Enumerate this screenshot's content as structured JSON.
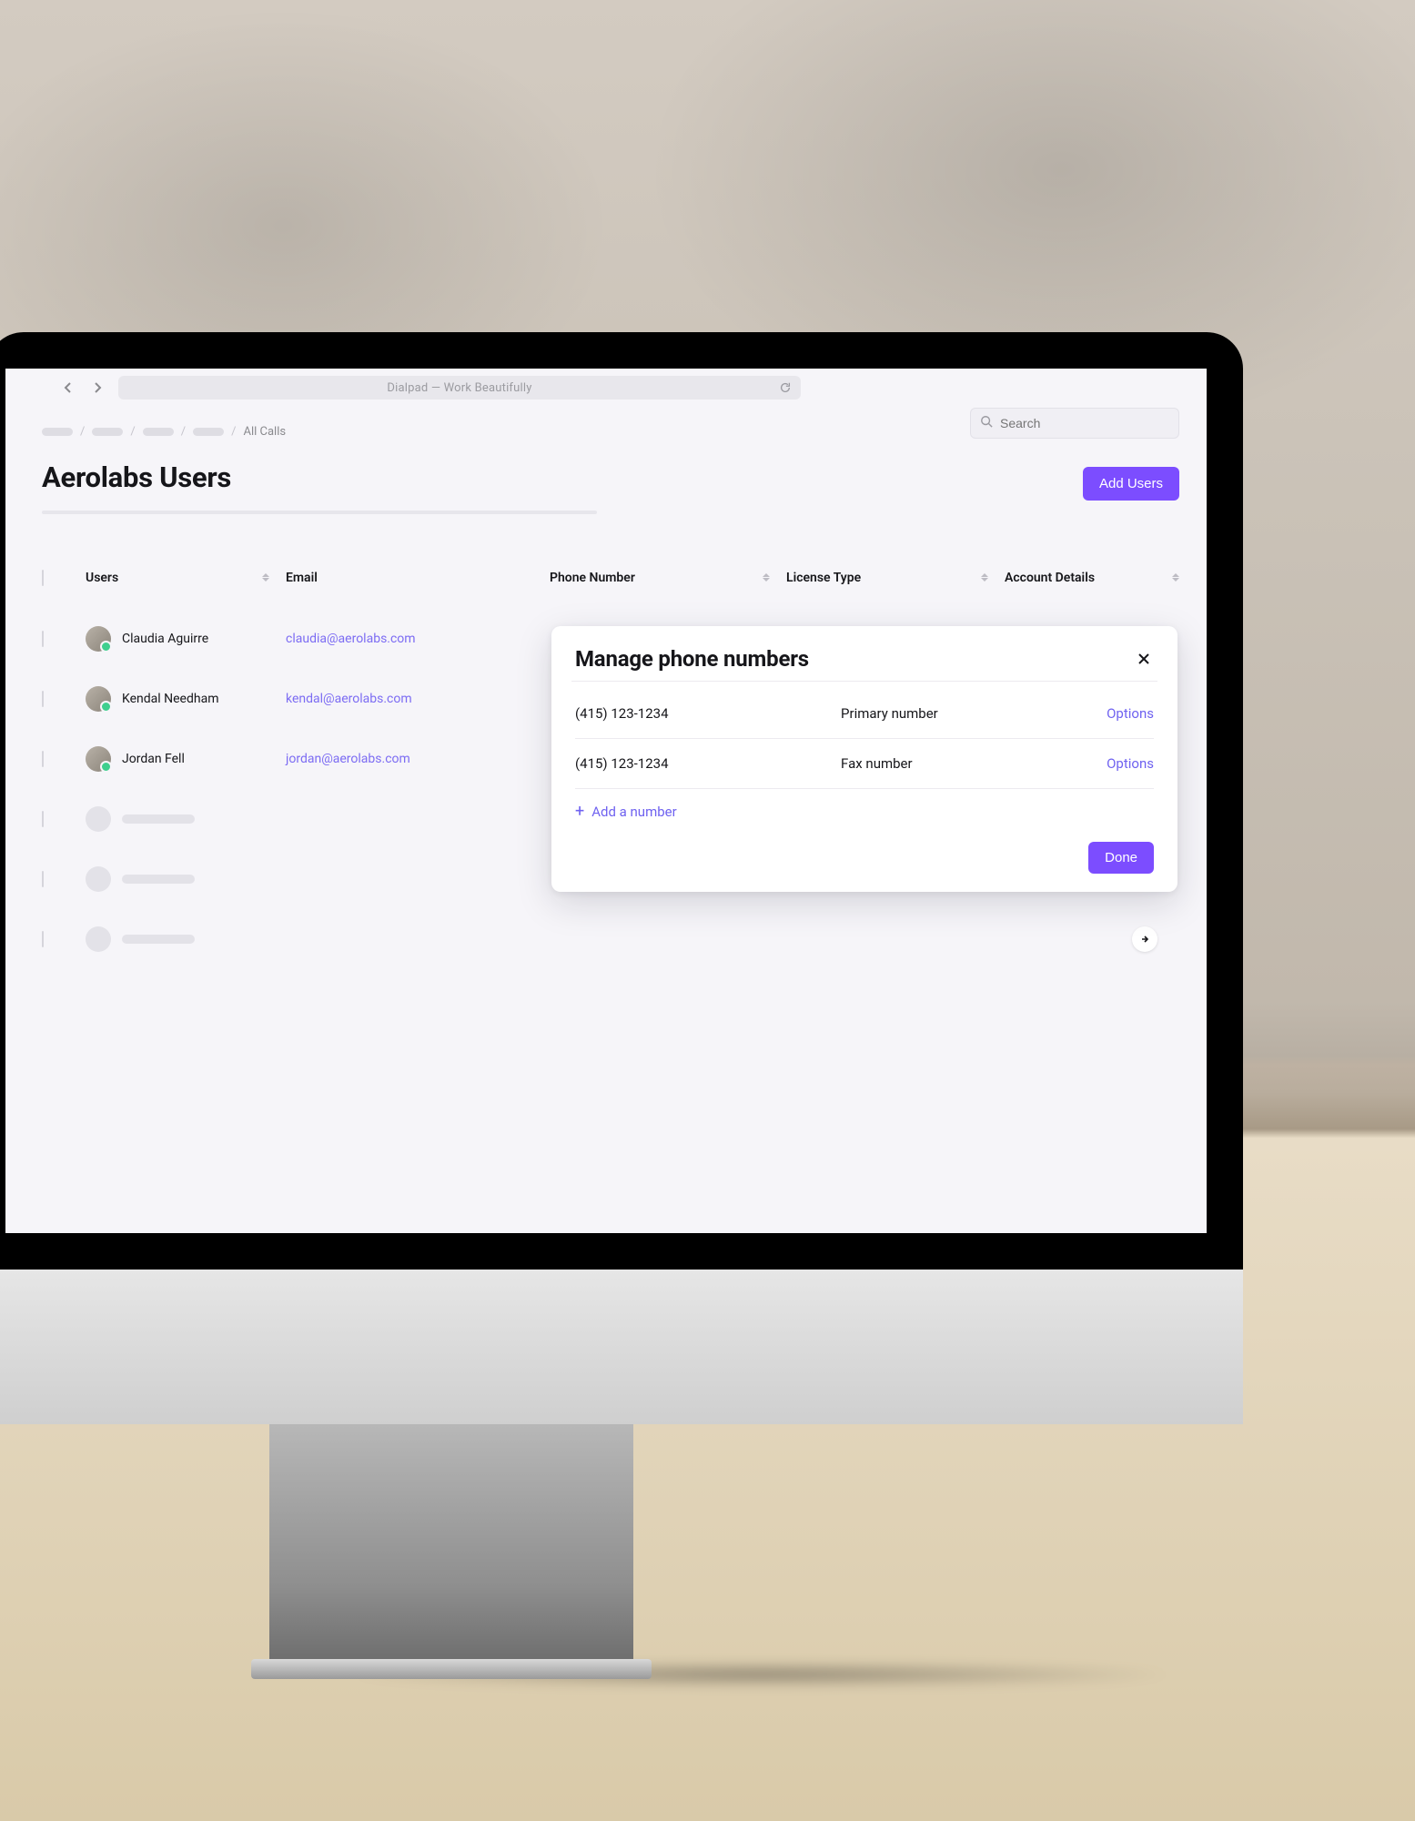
{
  "browser": {
    "title": "Dialpad — Work Beautifully"
  },
  "breadcrumbs": {
    "current": "All Calls"
  },
  "search": {
    "placeholder": "Search"
  },
  "page": {
    "title": "Aerolabs Users",
    "add_users_label": "Add Users"
  },
  "columns": {
    "users": "Users",
    "email": "Email",
    "phone": "Phone Number",
    "license": "License Type",
    "account": "Account Details"
  },
  "rows": [
    {
      "name": "Claudia Aguirre",
      "email": "claudia@aerolabs.com"
    },
    {
      "name": "Kendal Needham",
      "email": "kendal@aerolabs.com"
    },
    {
      "name": "Jordan Fell",
      "email": "jordan@aerolabs.com"
    }
  ],
  "modal": {
    "title": "Manage phone numbers",
    "numbers": [
      {
        "value": "(415) 123-1234",
        "label": "Primary number",
        "options": "Options"
      },
      {
        "value": "(415) 123-1234",
        "label": "Fax number",
        "options": "Options"
      }
    ],
    "add_label": "Add a number",
    "done_label": "Done"
  },
  "colors": {
    "accent": "#7c4dff",
    "link": "#6f62f0"
  }
}
